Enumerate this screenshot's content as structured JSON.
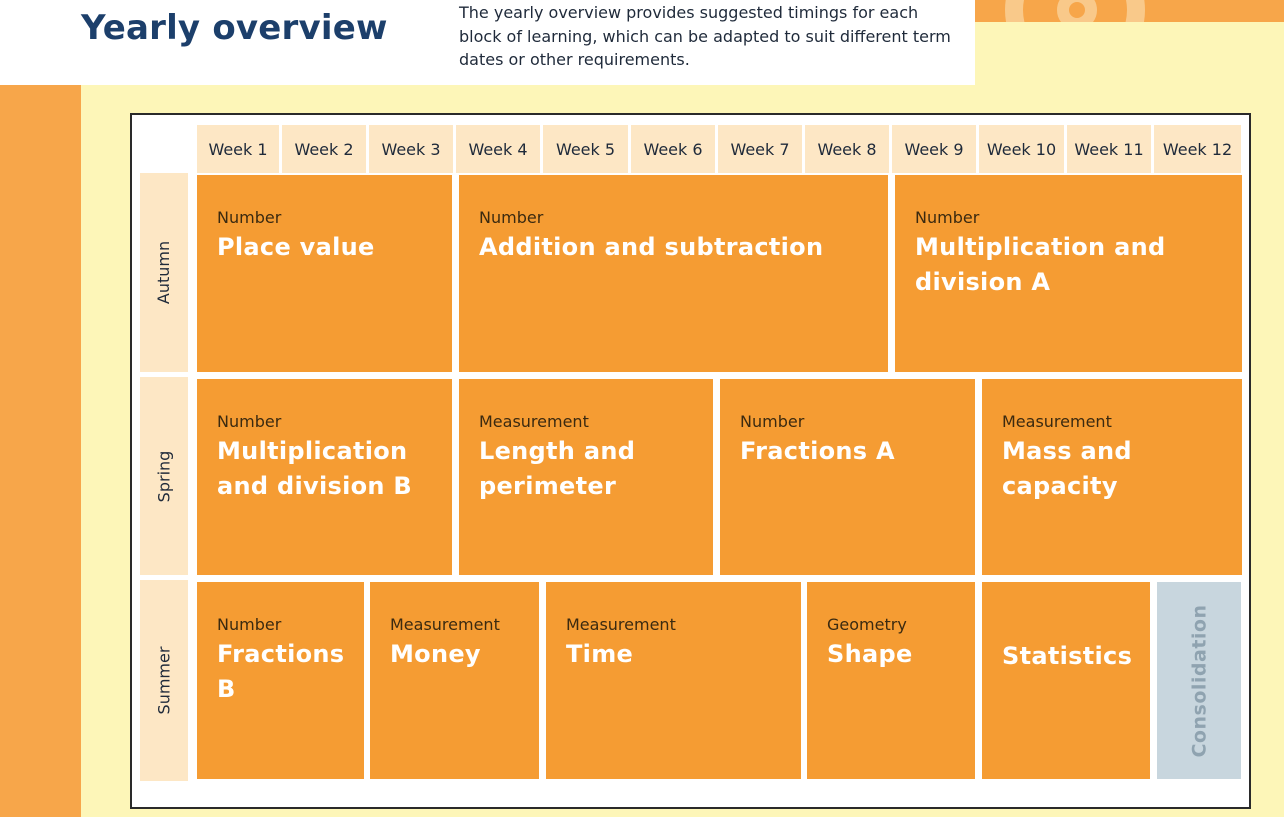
{
  "header": {
    "title": "Yearly overview",
    "intro": "The yearly overview provides suggested timings for each block of learning, which can be adapted to suit different term dates or other requirements."
  },
  "weeks": [
    "Week 1",
    "Week 2",
    "Week 3",
    "Week 4",
    "Week 5",
    "Week 6",
    "Week 7",
    "Week 8",
    "Week 9",
    "Week 10",
    "Week 11",
    "Week 12"
  ],
  "terms": {
    "autumn": {
      "label": "Autumn",
      "blocks": [
        {
          "category": "Number",
          "name": "Place value",
          "weeks": 3
        },
        {
          "category": "Number",
          "name": "Addition and subtraction",
          "weeks": 5
        },
        {
          "category": "Number",
          "name": "Multiplication and division A",
          "weeks": 4
        }
      ]
    },
    "spring": {
      "label": "Spring",
      "blocks": [
        {
          "category": "Number",
          "name": "Multiplication and division B",
          "weeks": 3
        },
        {
          "category": "Measurement",
          "name": "Length and perimeter",
          "weeks": 3
        },
        {
          "category": "Number",
          "name": "Fractions A",
          "weeks": 3
        },
        {
          "category": "Measurement",
          "name": "Mass and capacity",
          "weeks": 3
        }
      ]
    },
    "summer": {
      "label": "Summer",
      "blocks": [
        {
          "category": "Number",
          "name": "Fractions B",
          "weeks": 2
        },
        {
          "category": "Measurement",
          "name": "Money",
          "weeks": 2
        },
        {
          "category": "Measurement",
          "name": "Time",
          "weeks": 3
        },
        {
          "category": "Geometry",
          "name": "Shape",
          "weeks": 2
        },
        {
          "category": "",
          "name": "Statistics",
          "weeks": 2
        },
        {
          "category": "",
          "name": "Consolidation",
          "weeks": 1
        }
      ]
    }
  },
  "colors": {
    "title": "#1c3f6b",
    "block": "#f59c33",
    "header_cell": "#fde7c5",
    "consolidation": "#c8d6de",
    "background": "#fdf6b8",
    "stripe": "#f7a64a"
  }
}
